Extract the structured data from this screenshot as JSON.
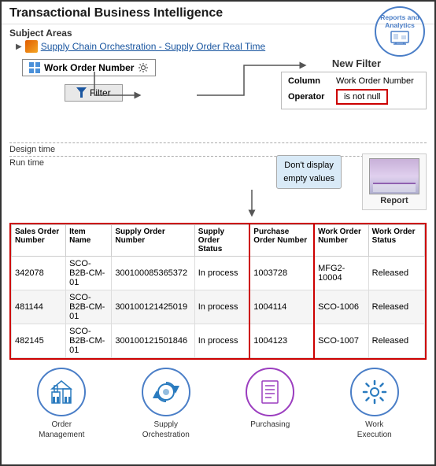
{
  "header": {
    "title": "Transactional Business Intelligence",
    "reports_label": "Reports and Analytics"
  },
  "subject_areas": {
    "label": "Subject Areas",
    "item": "Supply Chain Orchestration - Supply Order Real Time"
  },
  "filter_area": {
    "work_order_label": "Work Order Number",
    "filter_label": "Filter",
    "new_filter_label": "New Filter",
    "column_label": "Column",
    "column_value": "Work Order Number",
    "operator_label": "Operator",
    "operator_value": "is not null"
  },
  "labels": {
    "design_time": "Design time",
    "run_time": "Run time",
    "dont_display": "Don't display\nempty values",
    "report": "Report"
  },
  "table": {
    "columns": [
      "Sales Order Number",
      "Item Name",
      "Supply Order Number",
      "Supply Order Status",
      "Purchase Order Number",
      "Work Order Number",
      "Work Order Status"
    ],
    "rows": [
      [
        "342078",
        "SCO-B2B-CM-01",
        "300100085365372",
        "In process",
        "1003728",
        "MFG2-10004",
        "Released"
      ],
      [
        "481144",
        "SCO-B2B-CM-01",
        "300100121425019",
        "In process",
        "1004114",
        "SCO-1006",
        "Released"
      ],
      [
        "482145",
        "SCO-B2B-CM-01",
        "300100121501846",
        "In process",
        "1004123",
        "SCO-1007",
        "Released"
      ]
    ]
  },
  "bottom_icons": [
    {
      "id": "order-management",
      "label": "Order\nManagement",
      "color": "#2a7bbf"
    },
    {
      "id": "supply-orchestration",
      "label": "Supply\nOrchestration",
      "color": "#2a7bbf"
    },
    {
      "id": "purchasing",
      "label": "Purchasing",
      "color": "#9b3dbf"
    },
    {
      "id": "work-execution",
      "label": "Work\nExecution",
      "color": "#2a7bbf"
    }
  ]
}
